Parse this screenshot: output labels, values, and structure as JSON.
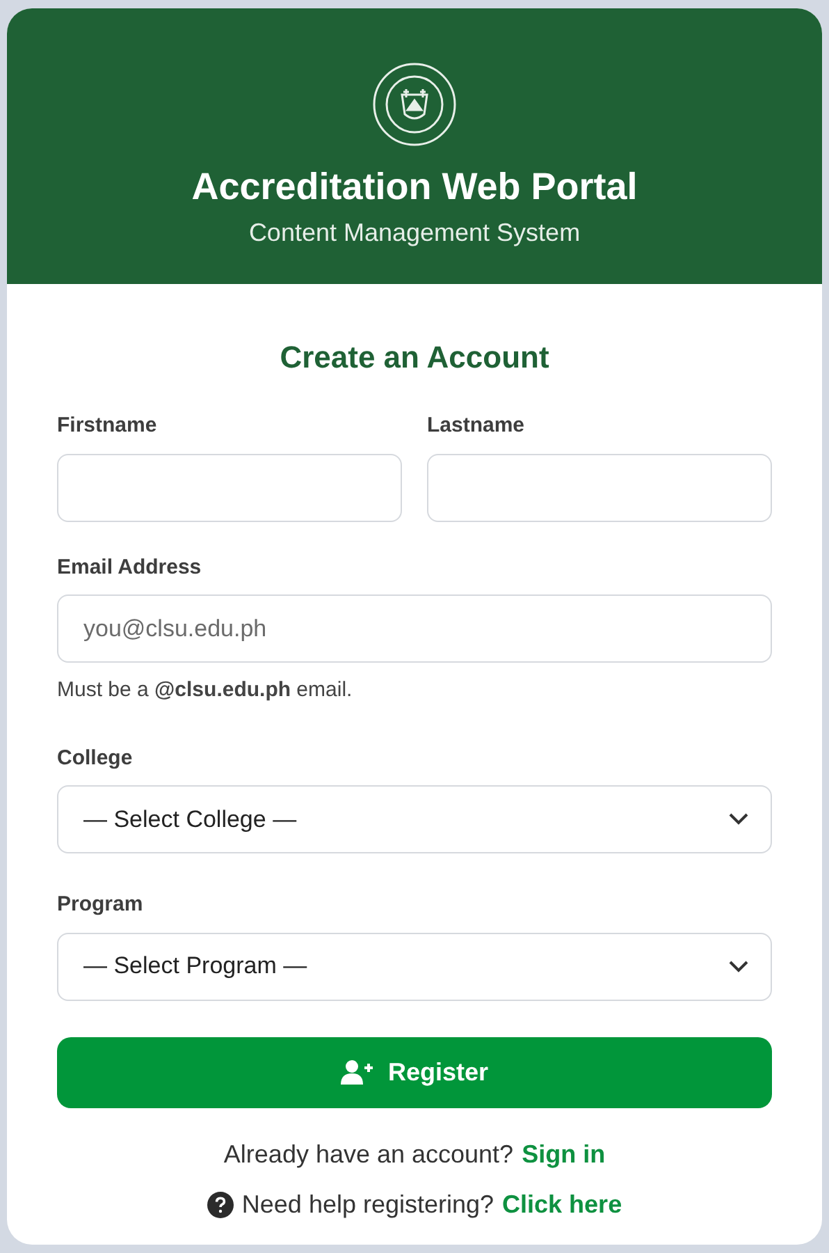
{
  "header": {
    "title": "Accreditation Web Portal",
    "subtitle": "Content Management System"
  },
  "form": {
    "heading": "Create an Account",
    "name_fields": [
      {
        "label": "Firstname"
      },
      {
        "label": "Lastname"
      }
    ],
    "email": {
      "label": "Email Address",
      "placeholder": "you@clsu.edu.ph",
      "hint": "Must be a **@clsu.edu.ph** email."
    },
    "selects": [
      {
        "label": "College",
        "value": "— Select College —"
      },
      {
        "label": "Program",
        "value": "— Select Program —"
      }
    ],
    "submit": "Register"
  },
  "footer_links": [
    {
      "kind": "plain",
      "text": "Already have an account?",
      "link": "Sign in"
    },
    {
      "kind": "help",
      "text": "Need help registering?",
      "link": "Click here"
    }
  ]
}
